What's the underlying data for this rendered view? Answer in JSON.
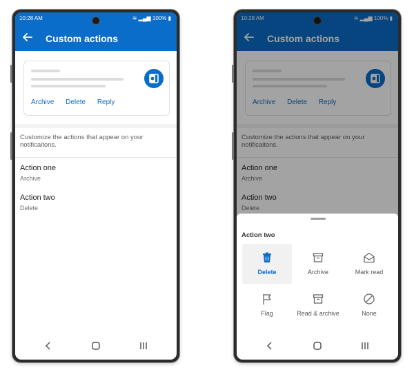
{
  "status": {
    "time": "10:28 AM",
    "battery": "100%"
  },
  "appbar": {
    "title": "Custom actions"
  },
  "preview": {
    "actions": [
      "Archive",
      "Delete",
      "Reply"
    ]
  },
  "description": "Customize the actions that appear on your notificaitons.",
  "rows": [
    {
      "title": "Action one",
      "value": "Archive"
    },
    {
      "title": "Action two",
      "value": "Delete"
    }
  ],
  "sheet": {
    "title": "Action two",
    "options": [
      {
        "label": "Delete",
        "icon": "trash-icon",
        "selected": true
      },
      {
        "label": "Archive",
        "icon": "archive-icon"
      },
      {
        "label": "Mark read",
        "icon": "envelope-open-icon"
      },
      {
        "label": "Flag",
        "icon": "flag-icon"
      },
      {
        "label": "Read & archive",
        "icon": "archive-icon"
      },
      {
        "label": "None",
        "icon": "prohibited-icon"
      }
    ]
  },
  "colors": {
    "accent": "#0a6dc9",
    "scrim": "rgba(0,0,0,0.36)"
  }
}
